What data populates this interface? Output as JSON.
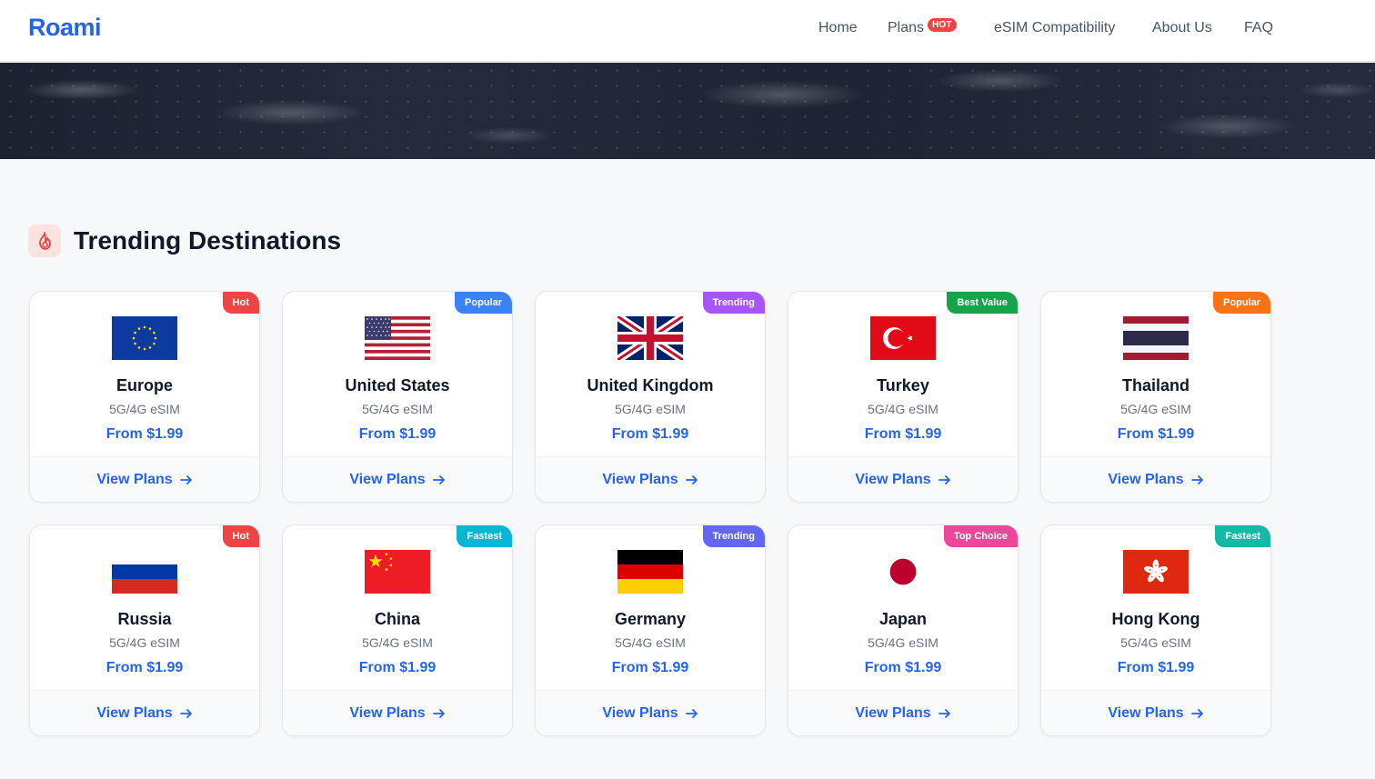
{
  "header": {
    "logo": "Roami",
    "nav": {
      "home": "Home",
      "plans": "Plans",
      "plans_badge": "HOT",
      "compat": "eSIM Compatibility",
      "about": "About Us",
      "faq": "FAQ"
    }
  },
  "section": {
    "title": "Trending Destinations",
    "icon": "fire-icon"
  },
  "colors": {
    "accent": "#2563eb",
    "hot": "#ef4444",
    "popular_blue": "#3b82f6",
    "trending": "#a855f7",
    "best_value": "#16a34a",
    "popular_orange": "#f97316",
    "fastest": "#06b6d4",
    "top_choice": "#ec4899",
    "fastest_teal": "#14b8a6"
  },
  "cards": [
    {
      "country": "Europe",
      "type": "5G/4G eSIM",
      "price": "From $1.99",
      "badge": "Hot",
      "badge_color": "#ef4444",
      "flag": "eu-flag-icon",
      "cta": "View Plans"
    },
    {
      "country": "United States",
      "type": "5G/4G eSIM",
      "price": "From $1.99",
      "badge": "Popular",
      "badge_color": "#3b82f6",
      "flag": "us-flag-icon",
      "cta": "View Plans"
    },
    {
      "country": "United Kingdom",
      "type": "5G/4G eSIM",
      "price": "From $1.99",
      "badge": "Trending",
      "badge_color": "#a855f7",
      "flag": "uk-flag-icon",
      "cta": "View Plans"
    },
    {
      "country": "Turkey",
      "type": "5G/4G eSIM",
      "price": "From $1.99",
      "badge": "Best Value",
      "badge_color": "#16a34a",
      "flag": "turkey-flag-icon",
      "cta": "View Plans"
    },
    {
      "country": "Thailand",
      "type": "5G/4G eSIM",
      "price": "From $1.99",
      "badge": "Popular",
      "badge_color": "#f97316",
      "flag": "thailand-flag-icon",
      "cta": "View Plans"
    },
    {
      "country": "Russia",
      "type": "5G/4G eSIM",
      "price": "From $1.99",
      "badge": "Hot",
      "badge_color": "#ef4444",
      "flag": "russia-flag-icon",
      "cta": "View Plans"
    },
    {
      "country": "China",
      "type": "5G/4G eSIM",
      "price": "From $1.99",
      "badge": "Fastest",
      "badge_color": "#06b6d4",
      "flag": "china-flag-icon",
      "cta": "View Plans"
    },
    {
      "country": "Germany",
      "type": "5G/4G eSIM",
      "price": "From $1.99",
      "badge": "Trending",
      "badge_color": "#6366f1",
      "flag": "germany-flag-icon",
      "cta": "View Plans"
    },
    {
      "country": "Japan",
      "type": "5G/4G eSIM",
      "price": "From $1.99",
      "badge": "Top Choice",
      "badge_color": "#ec4899",
      "flag": "japan-flag-icon",
      "cta": "View Plans"
    },
    {
      "country": "Hong Kong",
      "type": "5G/4G eSIM",
      "price": "From $1.99",
      "badge": "Fastest",
      "badge_color": "#14b8a6",
      "flag": "hongkong-flag-icon",
      "cta": "View Plans"
    }
  ]
}
